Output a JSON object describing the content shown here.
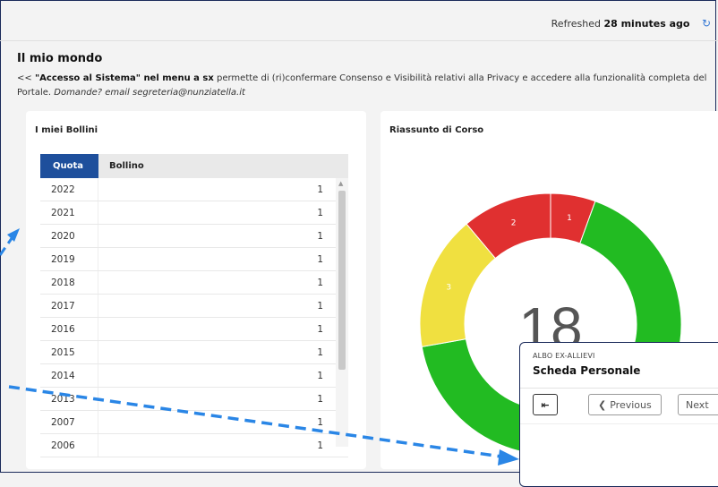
{
  "header": {
    "refresh_prefix": "Refreshed",
    "refresh_time": "28 minutes ago",
    "refresh_icon": "refresh-icon"
  },
  "page": {
    "title": "Il mio mondo",
    "desc_prefix": "<< ",
    "desc_bold": "\"Accesso al Sistema\" nel menu a sx",
    "desc_text": " permette di (ri)confermare Consenso e Visibilità relativi alla Privacy e accedere alla funzionalità completa del Portale. ",
    "desc_italic": "Domande? email segreteria@nunziatella.it"
  },
  "bollini": {
    "title": "I miei Bollini",
    "col_quota": "Quota",
    "col_bollino": "Bollino",
    "rows": [
      {
        "quota": "2022",
        "bollino": "1"
      },
      {
        "quota": "2021",
        "bollino": "1"
      },
      {
        "quota": "2020",
        "bollino": "1"
      },
      {
        "quota": "2019",
        "bollino": "1"
      },
      {
        "quota": "2018",
        "bollino": "1"
      },
      {
        "quota": "2017",
        "bollino": "1"
      },
      {
        "quota": "2016",
        "bollino": "1"
      },
      {
        "quota": "2015",
        "bollino": "1"
      },
      {
        "quota": "2014",
        "bollino": "1"
      },
      {
        "quota": "2013",
        "bollino": "1"
      },
      {
        "quota": "2007",
        "bollino": "1"
      },
      {
        "quota": "2006",
        "bollino": "1"
      }
    ]
  },
  "riassunto": {
    "title": "Riassunto di Corso",
    "total": "18",
    "segments": [
      {
        "label": "1",
        "value": 1,
        "color": "#e03030"
      },
      {
        "label": "",
        "value": 12,
        "color": "#22bb22"
      },
      {
        "label": "3",
        "value": 3,
        "color": "#f0e040"
      },
      {
        "label": "2",
        "value": 2,
        "color": "#e03030"
      }
    ]
  },
  "popup": {
    "section": "ALBO EX-ALLIEVI",
    "title": "Scheda Personale",
    "back_icon": "back-arrow-icon",
    "prev_label": "Previous",
    "next_label": "Next"
  },
  "colors": {
    "header_blue": "#1e4f9c",
    "accent_blue": "#3a7bd5"
  }
}
